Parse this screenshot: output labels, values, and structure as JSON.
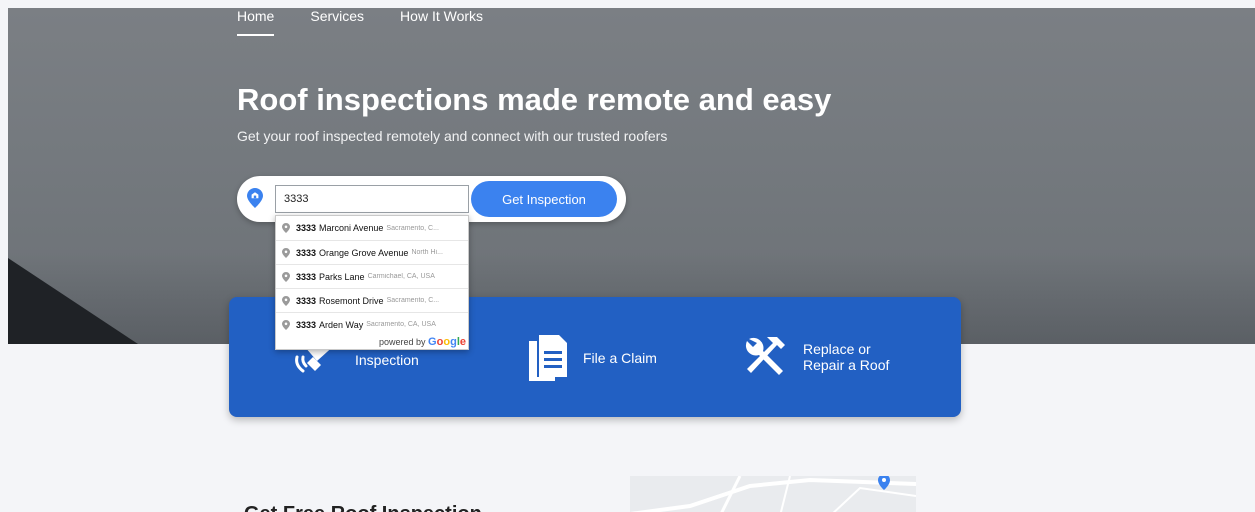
{
  "nav": {
    "items": [
      {
        "label": "Home"
      },
      {
        "label": "Services"
      },
      {
        "label": "How It Works"
      }
    ]
  },
  "hero": {
    "title": "Roof inspections made remote and easy",
    "subtitle": "Get your roof inspected remotely and connect with our trusted roofers"
  },
  "search": {
    "value": "3333",
    "button_label": "Get Inspection",
    "suggestions": [
      {
        "number": "3333",
        "street": "Marconi Avenue",
        "location": "Sacramento, C..."
      },
      {
        "number": "3333",
        "street": "Orange Grove Avenue",
        "location": "North Hi..."
      },
      {
        "number": "3333",
        "street": "Parks Lane",
        "location": "Carmichael, CA, USA"
      },
      {
        "number": "3333",
        "street": "Rosemont Drive",
        "location": "Sacramento, C..."
      },
      {
        "number": "3333",
        "street": "Arden Way",
        "location": "Sacramento, CA, USA"
      }
    ],
    "powered_by": "powered by",
    "google": [
      "G",
      "o",
      "o",
      "g",
      "l",
      "e"
    ]
  },
  "services": {
    "items": [
      {
        "label": "Free\nInspection",
        "icon": "inspection-tools-icon"
      },
      {
        "label": "File a Claim",
        "icon": "documents-icon"
      },
      {
        "label": "Replace or\nRepair a Roof",
        "icon": "wrench-hammer-icon"
      }
    ]
  },
  "section": {
    "title": "Get Free Roof Inspection"
  },
  "colors": {
    "accent": "#3b82ef",
    "services_bg": "#2260c3"
  }
}
